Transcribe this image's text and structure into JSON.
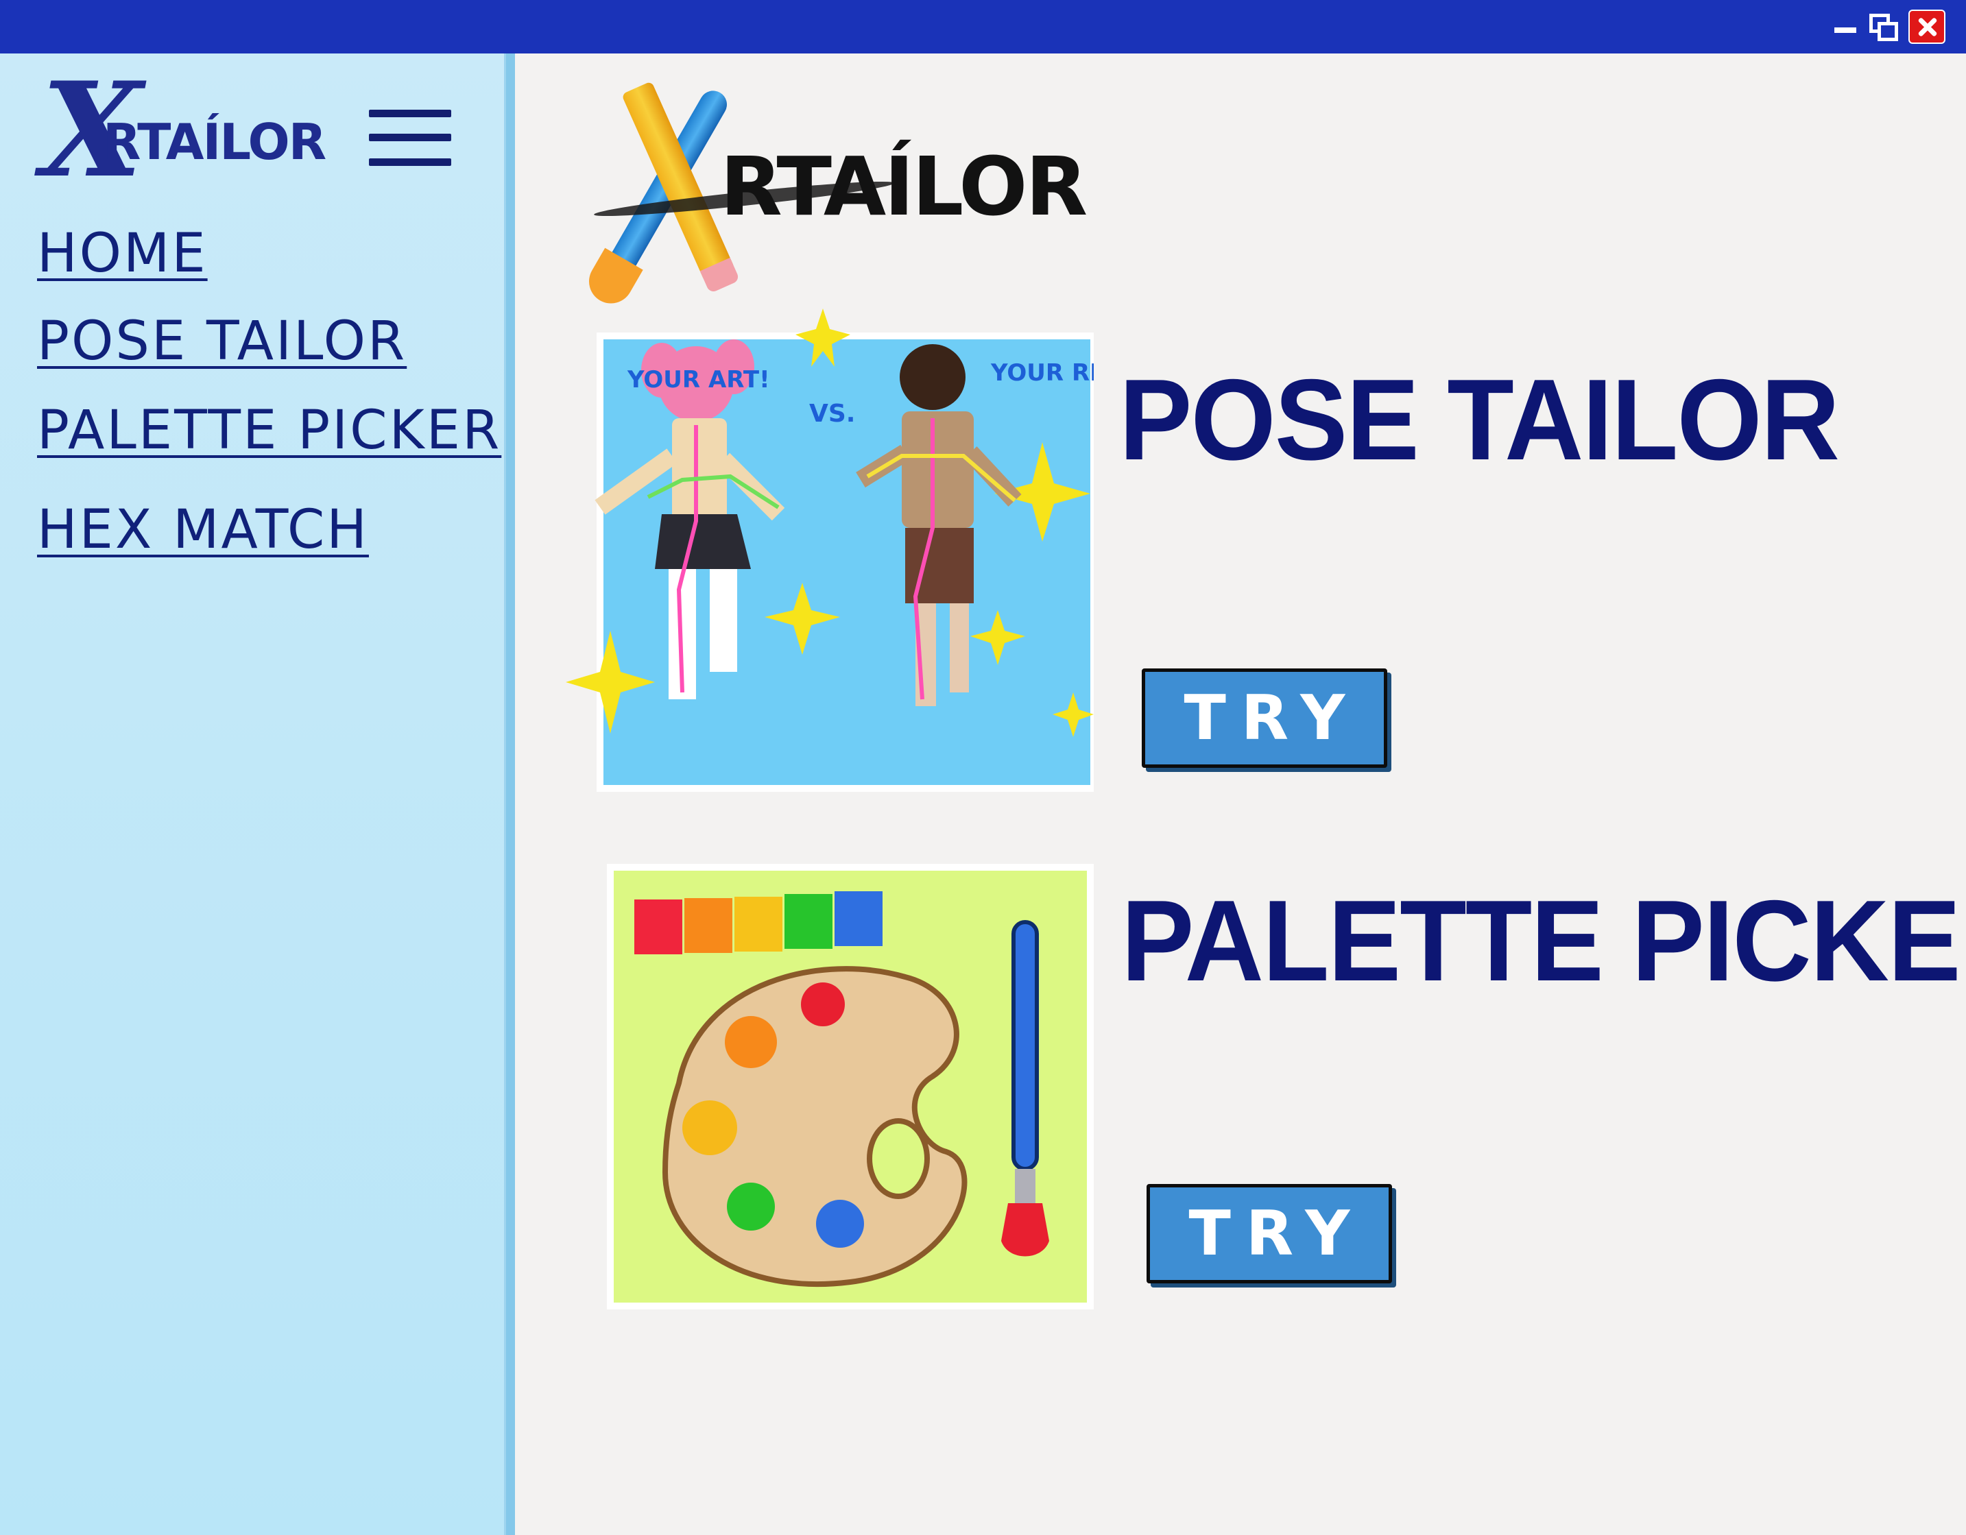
{
  "window": {
    "controls": [
      "minimize-icon",
      "restore-icon",
      "close-icon"
    ]
  },
  "sidebar": {
    "logo_text": "XRTAÍLOR",
    "logo_x": "X",
    "logo_rest": "RTAÍLOR",
    "nav": [
      {
        "label": "HOME"
      },
      {
        "label": "POSE TAILOR"
      },
      {
        "label": "PALETTE PICKER"
      },
      {
        "label": "HEX MATCH"
      }
    ]
  },
  "main": {
    "logo_text": "RTAÍLOR",
    "features": [
      {
        "title": "POSE TAILOR",
        "button_label": "TRY",
        "illustration_labels": [
          "YOUR ART!",
          "VS.",
          "YOUR REF!"
        ]
      },
      {
        "title": "PALETTE PICKER",
        "button_label": "TRY",
        "swatch_colors": [
          "#f0253c",
          "#f7891a",
          "#f6c21a",
          "#27c42c",
          "#2f6fe0"
        ]
      }
    ]
  },
  "colors": {
    "titlebar": "#1a33b8",
    "sidebar_bg": "#c3e8f8",
    "nav_text": "#10217a",
    "title_text": "#0d1673",
    "button_bg": "#3e8ed3"
  }
}
